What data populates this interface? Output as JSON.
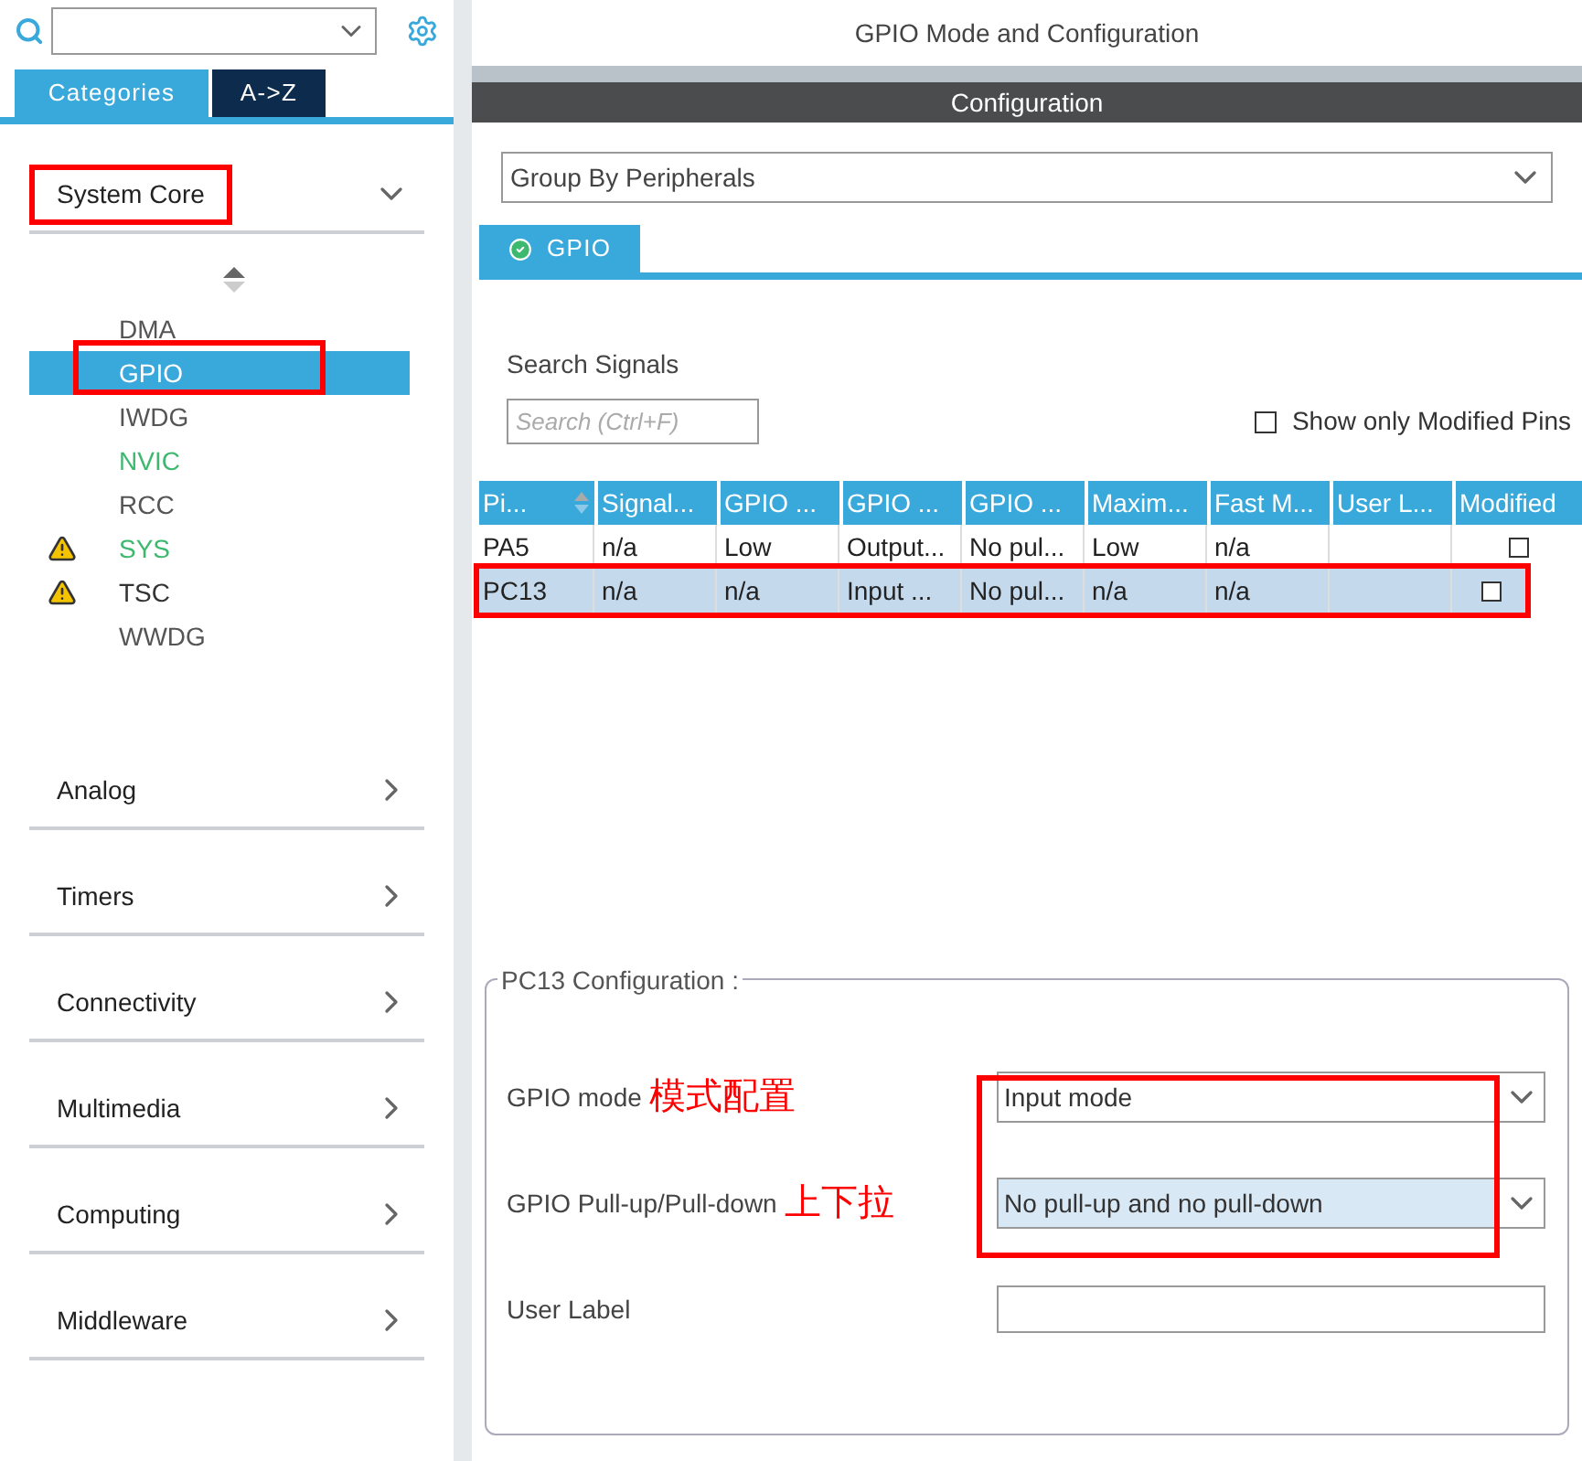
{
  "sidebar": {
    "tabs": [
      {
        "label": "Categories",
        "selected": true
      },
      {
        "label": "A->Z",
        "selected": false
      }
    ],
    "categories": [
      {
        "label": "System Core",
        "expanded": true,
        "highlighted": true,
        "items": [
          {
            "label": "DMA",
            "selected": false,
            "color": "#555555",
            "warning": false,
            "highlighted": false
          },
          {
            "label": "GPIO",
            "selected": true,
            "color": "#ffffff",
            "warning": false,
            "highlighted": true
          },
          {
            "label": "IWDG",
            "selected": false,
            "color": "#555555",
            "warning": false,
            "highlighted": false
          },
          {
            "label": "NVIC",
            "selected": false,
            "color": "#3db86f",
            "warning": false,
            "highlighted": false
          },
          {
            "label": "RCC",
            "selected": false,
            "color": "#555555",
            "warning": false,
            "highlighted": false
          },
          {
            "label": "SYS",
            "selected": false,
            "color": "#3db86f",
            "warning": true,
            "highlighted": false
          },
          {
            "label": "TSC",
            "selected": false,
            "color": "#333333",
            "warning": true,
            "highlighted": false
          },
          {
            "label": "WWDG",
            "selected": false,
            "color": "#555555",
            "warning": false,
            "highlighted": false
          }
        ]
      },
      {
        "label": "Analog",
        "expanded": false,
        "highlighted": false
      },
      {
        "label": "Timers",
        "expanded": false,
        "highlighted": false
      },
      {
        "label": "Connectivity",
        "expanded": false,
        "highlighted": false
      },
      {
        "label": "Multimedia",
        "expanded": false,
        "highlighted": false
      },
      {
        "label": "Computing",
        "expanded": false,
        "highlighted": false
      },
      {
        "label": "Middleware",
        "expanded": false,
        "highlighted": false
      }
    ]
  },
  "main": {
    "title": "GPIO Mode and Configuration",
    "config_bar": "Configuration",
    "group_by": "Group By Peripherals",
    "tabs": [
      {
        "label": "GPIO",
        "selected": true
      }
    ],
    "search_label": "Search Signals",
    "search": {
      "placeholder": "Search (Ctrl+F)"
    },
    "show_modified": {
      "label": "Show only Modified Pins",
      "checked": false
    },
    "table": {
      "columns": [
        "Pi...",
        "Signal...",
        "GPIO ...",
        "GPIO ...",
        "GPIO ...",
        "Maxim...",
        "Fast M...",
        "User L...",
        "Modified"
      ],
      "rows": [
        {
          "cells": [
            "PA5",
            "n/a",
            "Low",
            "Output...",
            "No pul...",
            "Low",
            "n/a",
            ""
          ],
          "modified": false,
          "selected": false,
          "highlighted": false
        },
        {
          "cells": [
            "PC13",
            "n/a",
            "n/a",
            "Input ...",
            "No pul...",
            "n/a",
            "n/a",
            ""
          ],
          "modified": false,
          "selected": true,
          "highlighted": true
        }
      ]
    },
    "config": {
      "title": "PC13 Configuration :",
      "fields": [
        {
          "label": "GPIO mode",
          "note": "模式配置",
          "kind": "select",
          "value": "Input mode",
          "focused": false
        },
        {
          "label": "GPIO Pull-up/Pull-down",
          "note": "上下拉",
          "kind": "select",
          "value": "No pull-up and no pull-down",
          "focused": true
        },
        {
          "label": "User Label",
          "kind": "text"
        }
      ]
    }
  }
}
